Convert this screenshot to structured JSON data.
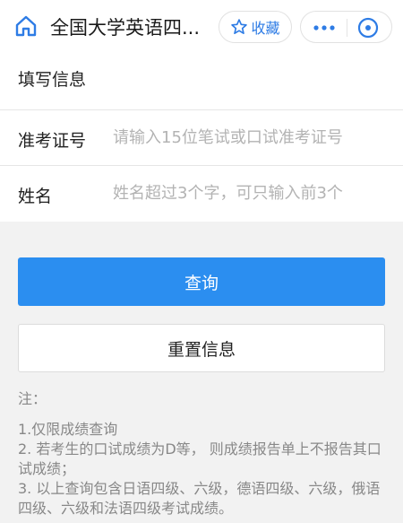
{
  "header": {
    "title": "全国大学英语四...",
    "favorite_label": "收藏",
    "icons": {
      "home": "home-icon",
      "favorite": "star-icon",
      "more": "more-icon",
      "close": "close-icon"
    },
    "accent_color": "#2e7ce5"
  },
  "form": {
    "section_title": "填写信息",
    "fields": [
      {
        "label": "准考证号",
        "placeholder": "请输入15位笔试或口试准考证号",
        "value": ""
      },
      {
        "label": "姓名",
        "placeholder": "姓名超过3个字，可只输入前3个",
        "value": ""
      }
    ]
  },
  "actions": {
    "query_label": "查询",
    "reset_label": "重置信息",
    "primary_color": "#2b8ef0"
  },
  "notes": {
    "title": "注：",
    "items": [
      "1.仅限成绩查询",
      "2. 若考生的口试成绩为D等， 则成绩报告单上不报告其口试成绩；",
      "3. 以上查询包含日语四级、六级，德语四级、六级，俄语四级、六级和法语四级考试成绩。"
    ]
  }
}
